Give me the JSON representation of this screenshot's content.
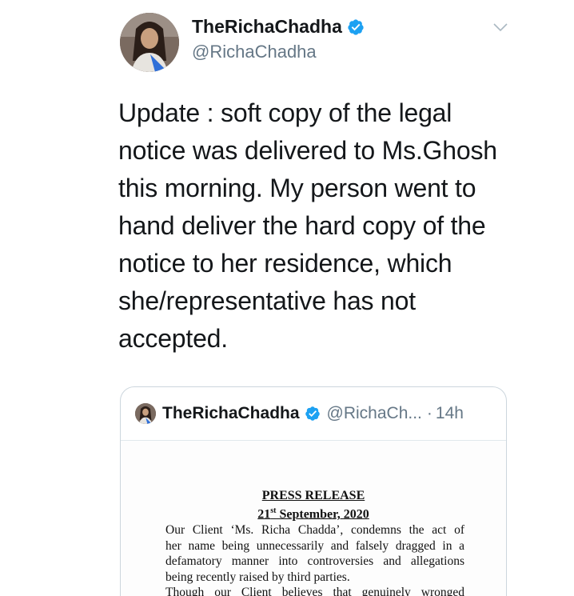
{
  "tweet": {
    "display_name": "TheRichaChadha",
    "handle": "@RichaChadha",
    "text_lines": [
      "Update : soft copy of the legal",
      "notice was delivered to Ms.Ghosh",
      "this morning. My person went to",
      "hand deliver the hard copy of the",
      "notice to her residence, which",
      "she/representative has not",
      "accepted."
    ]
  },
  "quoted_tweet": {
    "display_name": "TheRichaChadha",
    "handle": "@RichaCh...",
    "separator": "·",
    "time": "14h",
    "document": {
      "title": "PRESS RELEASE",
      "date_day": "21",
      "date_suffix": "st",
      "date_rest": " September, 2020",
      "lines": [
        "Our Client ‘Ms. Richa Chadda’, condemns the act of",
        "her name being unnecessarily and falsely dragged in a",
        "defamatory manner into controversies and allegations",
        "being recently raised by third parties.",
        "Though our Client believes that genuinely wronged"
      ]
    }
  },
  "colors": {
    "verified_blue": "#1da1f2",
    "secondary_text": "#657786",
    "border": "#ccd6dd"
  },
  "icons": {
    "verified": "verified-badge-icon",
    "caret": "chevron-down-icon"
  }
}
